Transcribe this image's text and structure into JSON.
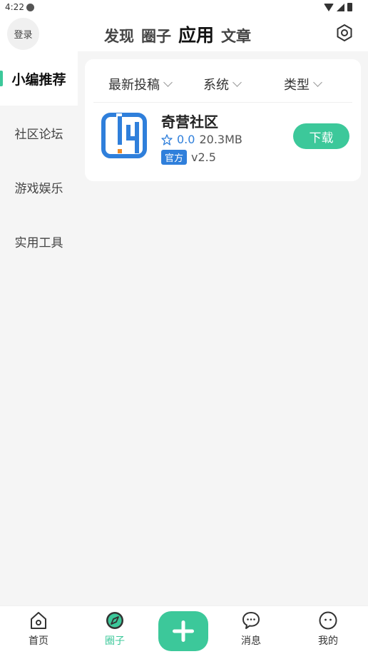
{
  "status_bar": {
    "time": "4:22"
  },
  "header": {
    "login_label": "登录",
    "tabs": [
      {
        "label": "发现"
      },
      {
        "label": "圈子"
      },
      {
        "label": "应用"
      },
      {
        "label": "文章"
      }
    ],
    "active_tab": "应用"
  },
  "sidebar": {
    "items": [
      {
        "label": "小编推荐"
      },
      {
        "label": "社区论坛"
      },
      {
        "label": "游戏娱乐"
      },
      {
        "label": "实用工具"
      }
    ],
    "active_item": "小编推荐"
  },
  "filters": {
    "latest": "最新投稿",
    "system": "系统",
    "type": "类型"
  },
  "apps": [
    {
      "name": "奇营社区",
      "rating": "0.0",
      "size": "20.3MB",
      "badge": "官方",
      "version": "v2.5",
      "action": "下载"
    }
  ],
  "bottom_nav": {
    "items": [
      {
        "label": "首页",
        "icon": "home-icon"
      },
      {
        "label": "圈子",
        "icon": "compass-icon"
      },
      {
        "label": "",
        "icon": "plus-icon"
      },
      {
        "label": "消息",
        "icon": "chat-icon"
      },
      {
        "label": "我的",
        "icon": "face-icon"
      }
    ],
    "active": "圈子"
  },
  "colors": {
    "accent": "#3cc89a",
    "link_blue": "#2f7fdb",
    "background": "#f5f5f5"
  }
}
